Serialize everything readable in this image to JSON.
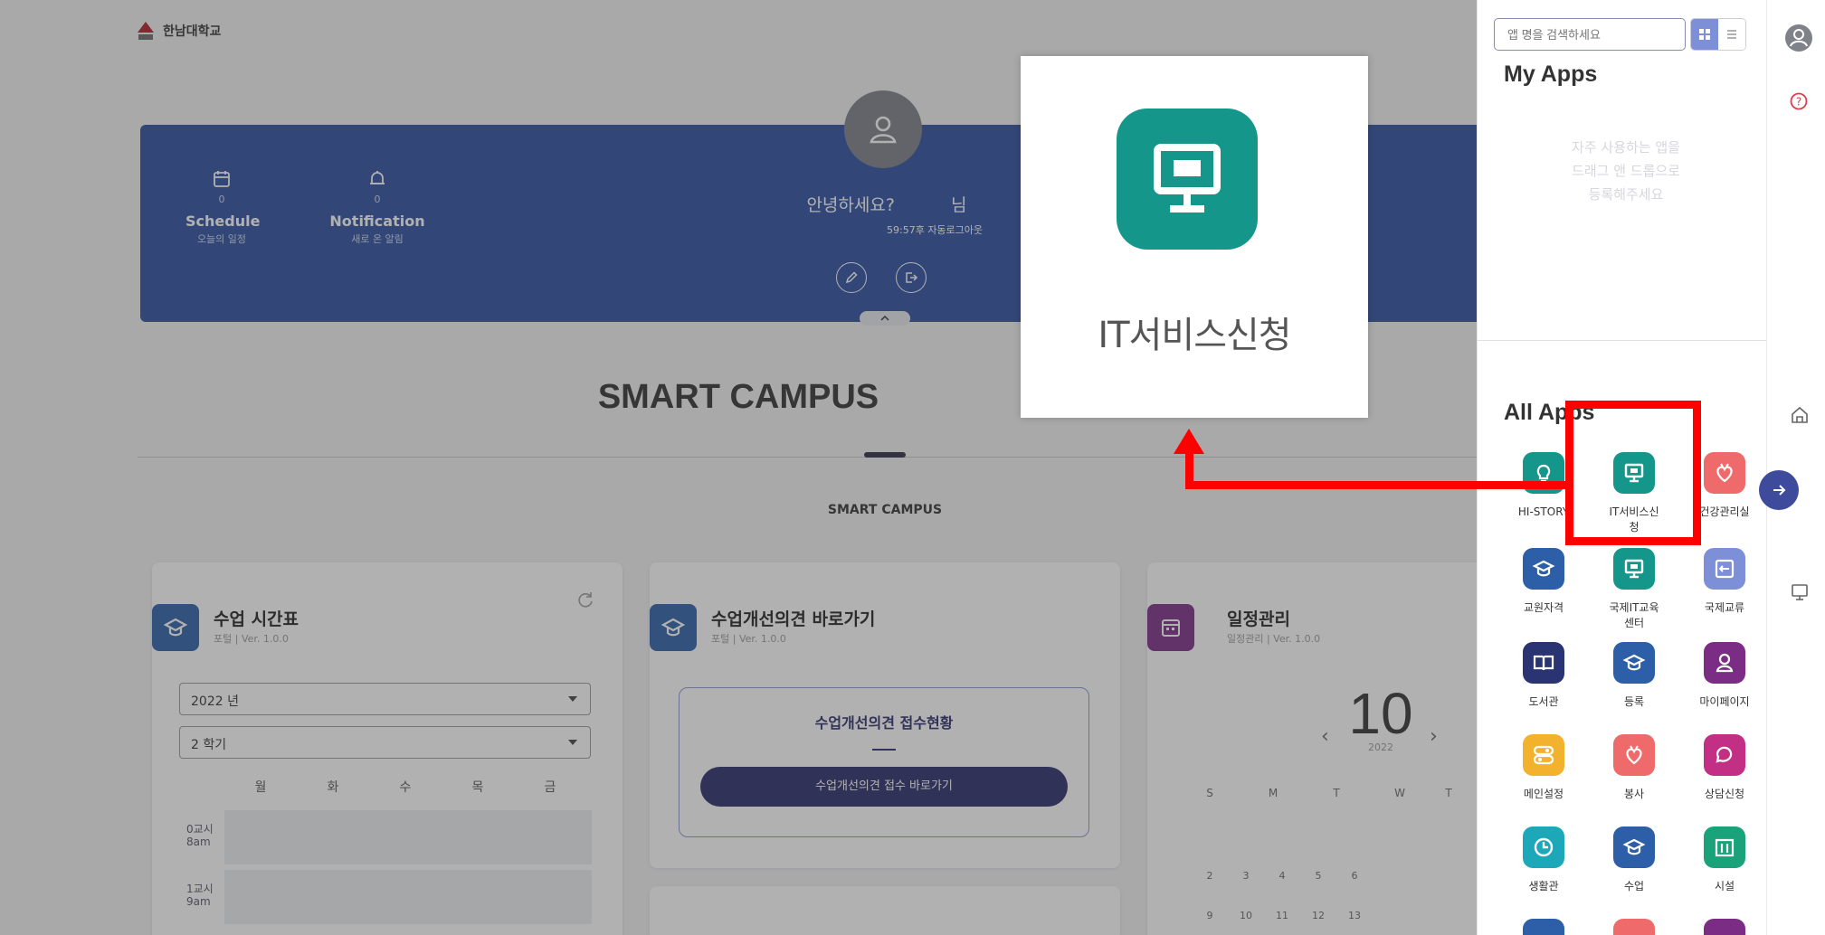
{
  "header": {
    "school_name": "한남대학교"
  },
  "banner": {
    "schedule": {
      "label": "Schedule",
      "count": "0",
      "sub": "오늘의 일정"
    },
    "notification": {
      "label": "Notification",
      "count": "0",
      "sub": "새로 온 알림"
    },
    "greeting": "안녕하세요?",
    "greeting_suffix": "님",
    "auto_logout": "59:57후 자동로그아웃"
  },
  "main": {
    "title": "SMART CAMPUS",
    "tab_label": "SMART CAMPUS"
  },
  "cards": {
    "timetable": {
      "title": "수업 시간표",
      "sub": "포털 | Ver. 1.0.0",
      "year": "2022 년",
      "semester": "2 학기",
      "days": [
        "월",
        "화",
        "수",
        "목",
        "금"
      ],
      "periods": [
        [
          "0교시",
          "8am"
        ],
        [
          "1교시",
          "9am"
        ]
      ]
    },
    "improve": {
      "title": "수업개선의견 바로가기",
      "sub": "포털 | Ver. 1.0.0",
      "box_title": "수업개선의견 접수현황",
      "button": "수업개선의견 접수 바로가기"
    },
    "schedule": {
      "title": "일정관리",
      "sub": "일정관리 | Ver. 1.0.0",
      "month": "10",
      "year": "2022",
      "weekdays": [
        "S",
        "M",
        "T",
        "W",
        "T"
      ],
      "row1": [
        "2",
        "3",
        "4",
        "5",
        "6"
      ],
      "row2": [
        "9",
        "10",
        "11",
        "12",
        "13"
      ]
    }
  },
  "panel": {
    "search_placeholder": "앱 명을 검색하세요",
    "my_apps_title": "My Apps",
    "drag_hint": [
      "자주 사용하는 앱을",
      "드래그 앤 드롭으로",
      "등록해주세요"
    ],
    "all_apps_title": "All Apps",
    "apps": [
      {
        "label": "HI-STORY",
        "icon": "lightbulb-icon",
        "color": "#14968b"
      },
      {
        "label": "IT서비스신청",
        "icon": "monitor-icon",
        "color": "#14968b"
      },
      {
        "label": "건강관리실",
        "icon": "heart-icon",
        "color": "#ef6a6a"
      },
      {
        "label": "교원자격",
        "icon": "graduation-cap-icon",
        "color": "#2c5fa8"
      },
      {
        "label": "국제IT교육센터",
        "icon": "monitor-icon",
        "color": "#14968b"
      },
      {
        "label": "국제교류",
        "icon": "exchange-icon",
        "color": "#7d8fd6"
      },
      {
        "label": "도서관",
        "icon": "book-icon",
        "color": "#2a3473"
      },
      {
        "label": "등록",
        "icon": "graduation-cap-icon",
        "color": "#2c5fa8"
      },
      {
        "label": "마이페이지",
        "icon": "person-icon",
        "color": "#7b2d86"
      },
      {
        "label": "메인설정",
        "icon": "settings-toggle-icon",
        "color": "#f3b22d"
      },
      {
        "label": "봉사",
        "icon": "heart-icon",
        "color": "#ef6a6a"
      },
      {
        "label": "상담신청",
        "icon": "chat-icon",
        "color": "#c42f86"
      },
      {
        "label": "생활관",
        "icon": "clock-icon",
        "color": "#1ca8b8"
      },
      {
        "label": "수업",
        "icon": "graduation-cap-icon",
        "color": "#2c5fa8"
      },
      {
        "label": "시설",
        "icon": "building-icon",
        "color": "#1aa37a"
      }
    ]
  },
  "zoom_callout": {
    "label": "IT서비스신청",
    "icon": "monitor-icon"
  }
}
